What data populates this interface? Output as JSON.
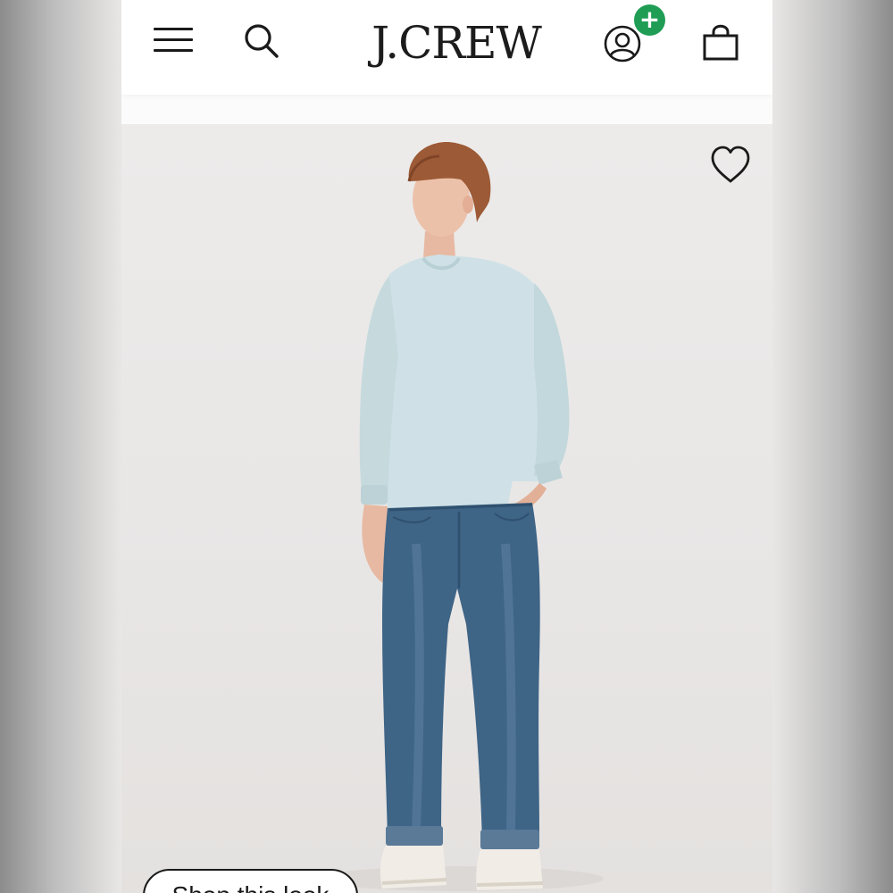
{
  "header": {
    "brand": "J.CREW",
    "menu_icon": "hamburger-menu-icon",
    "search_icon": "search-icon",
    "account_icon": "account-icon",
    "account_badge": "+",
    "bag_icon": "shopping-bag-icon"
  },
  "product": {
    "wishlist_icon": "heart-outline-icon",
    "shop_look_label": "Shop this look"
  },
  "colors": {
    "badge_green": "#1f9d55",
    "text_dark": "#1a1a1a",
    "image_background": "#e9e7e6",
    "sweater": "#cfe1e6",
    "denim": "#3e6486"
  }
}
